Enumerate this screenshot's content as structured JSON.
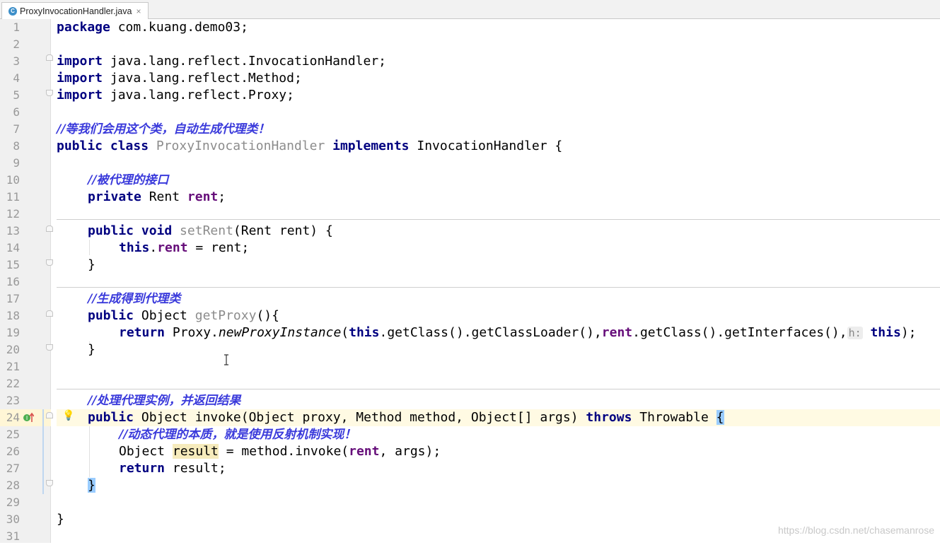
{
  "tab": {
    "icon": "C",
    "title": "ProxyInvocationHandler.java",
    "close": "×"
  },
  "line_numbers": [
    "1",
    "2",
    "3",
    "4",
    "5",
    "6",
    "7",
    "8",
    "9",
    "10",
    "11",
    "12",
    "13",
    "14",
    "15",
    "16",
    "17",
    "18",
    "19",
    "20",
    "21",
    "22",
    "23",
    "24",
    "25",
    "26",
    "27",
    "28",
    "29",
    "30",
    "31"
  ],
  "code": {
    "l1_a": "package",
    "l1_b": " com.kuang.demo03;",
    "imp": "import",
    "l3_b": " java.lang.reflect.InvocationHandler;",
    "l4_b": " java.lang.reflect.Method;",
    "l5_b": " java.lang.reflect.Proxy;",
    "l7": "//等我们会用这个类，自动生成代理类！",
    "l8_a": "public class",
    "l8_b": " ProxyInvocationHandler",
    "l8_c": " implements",
    "l8_d": " InvocationHandler {",
    "l10": "//被代理的接口",
    "l11_a": "private",
    "l11_b": " Rent ",
    "l11_c": "rent",
    "l11_d": ";",
    "l13_a": "public void",
    "l13_b": " setRent",
    "l13_c": "(Rent rent) {",
    "l14_a": "this",
    "l14_b": ".",
    "l14_c": "rent",
    "l14_d": " = rent;",
    "close_brace": "}",
    "l17": "//生成得到代理类",
    "pub": "public",
    "l18_b": " Object ",
    "l18_c": "getProxy",
    "l18_d": "(){",
    "l19_a": "return",
    "l19_b": " Proxy.",
    "l19_c": "newProxyInstance",
    "l19_d": "(",
    "l19_e": "this",
    "l19_f": ".getClass().getClassLoader(),",
    "l19_g": "rent",
    "l19_h": ".getClass().getInterfaces(),",
    "l19_hint": "h:",
    "l19_i": " this",
    "l19_j": ");",
    "l23": "//处理代理实例，并返回结果",
    "l24_b": " Object invoke(Object proxy, Method method, Object[] args) ",
    "l24_c": "throws",
    "l24_d": " Throwable ",
    "l24_e": "{",
    "l25": "//动态代理的本质，就是使用反射机制实现！",
    "l26_a": "Object ",
    "l26_b": "result",
    "l26_c": " = method.invoke(",
    "l26_d": "rent",
    "l26_e": ", args);",
    "l27_a": "return",
    "l27_b": " result;"
  },
  "watermark": "https://blog.csdn.net/chasemanrose"
}
